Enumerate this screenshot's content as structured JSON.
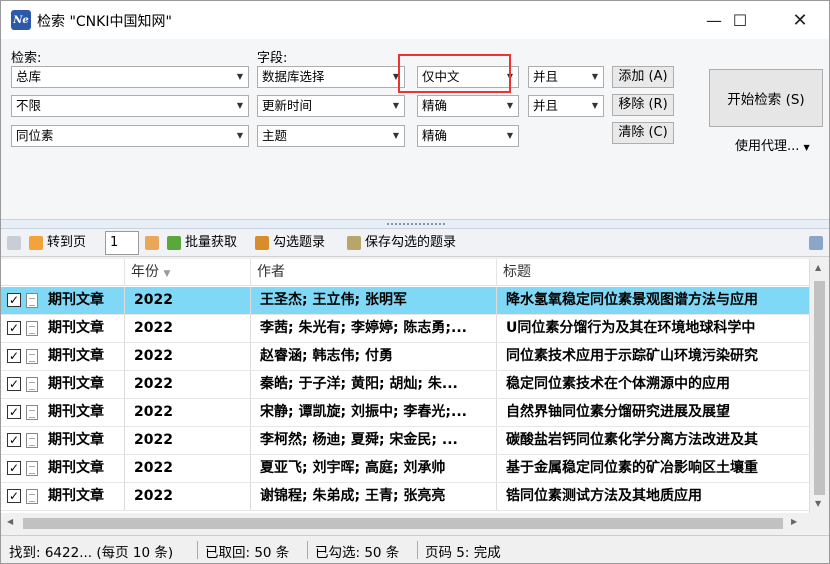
{
  "window": {
    "title": "检索 \"CNKI中国知网\"",
    "icon_text": "Ne",
    "controls": [
      "minimize-icon",
      "maximize-icon",
      "close-icon"
    ]
  },
  "search": {
    "label_search": "检索:",
    "label_field": "字段:",
    "rows": [
      {
        "scope": "总库",
        "field": "数据库选择",
        "option": "仅中文",
        "logic": "并且",
        "action": "添加 (A)"
      },
      {
        "scope": "不限",
        "field": "更新时间",
        "option": "精确",
        "logic": "并且",
        "action": "移除 (R)"
      },
      {
        "scope": "同位素",
        "field": "主题",
        "option": "精确",
        "logic": "",
        "action": "清除 (C)"
      }
    ],
    "start_button": "开始检索 (S)",
    "proxy_menu": "使用代理..."
  },
  "toolbar": {
    "goto_page": "转到页",
    "page_value": "1",
    "batch_fetch": "批量获取",
    "select_records": "勾选题录",
    "save_selected": "保存勾选的题录"
  },
  "table": {
    "columns": [
      "年份",
      "作者",
      "标题"
    ],
    "rows": [
      {
        "type": "期刊文章",
        "year": "2022",
        "authors": "王圣杰; 王立伟; 张明军",
        "title": "降水氢氧稳定同位素景观图谱方法与应用"
      },
      {
        "type": "期刊文章",
        "year": "2022",
        "authors": "李茜; 朱光有; 李婷婷; 陈志勇;...",
        "title": "U同位素分馏行为及其在环境地球科学中"
      },
      {
        "type": "期刊文章",
        "year": "2022",
        "authors": "赵睿涵; 韩志伟; 付勇",
        "title": "同位素技术应用于示踪矿山环境污染研究"
      },
      {
        "type": "期刊文章",
        "year": "2022",
        "authors": "秦皓; 于子洋; 黄阳; 胡灿; 朱...",
        "title": "稳定同位素技术在个体溯源中的应用"
      },
      {
        "type": "期刊文章",
        "year": "2022",
        "authors": "宋静; 谭凯旋; 刘振中; 李春光;...",
        "title": "自然界铀同位素分馏研究进展及展望"
      },
      {
        "type": "期刊文章",
        "year": "2022",
        "authors": "李柯然; 杨迪; 夏舜; 宋金民; ...",
        "title": "碳酸盐岩钙同位素化学分离方法改进及其"
      },
      {
        "type": "期刊文章",
        "year": "2022",
        "authors": "夏亚飞; 刘宇晖; 高庭; 刘承帅",
        "title": "基于金属稳定同位素的矿冶影响区土壤重"
      },
      {
        "type": "期刊文章",
        "year": "2022",
        "authors": "谢锦程; 朱弟成; 王青; 张亮亮",
        "title": "锆同位素测试方法及其地质应用"
      }
    ]
  },
  "status": {
    "found": "找到: 6422... (每页 10 条)",
    "fetched": "已取回: 50 条",
    "checked": "已勾选: 50 条",
    "page": "页码 5: 完成"
  },
  "colors": {
    "selected_row": "#7fd8f5",
    "highlight_box": "#e33333"
  }
}
